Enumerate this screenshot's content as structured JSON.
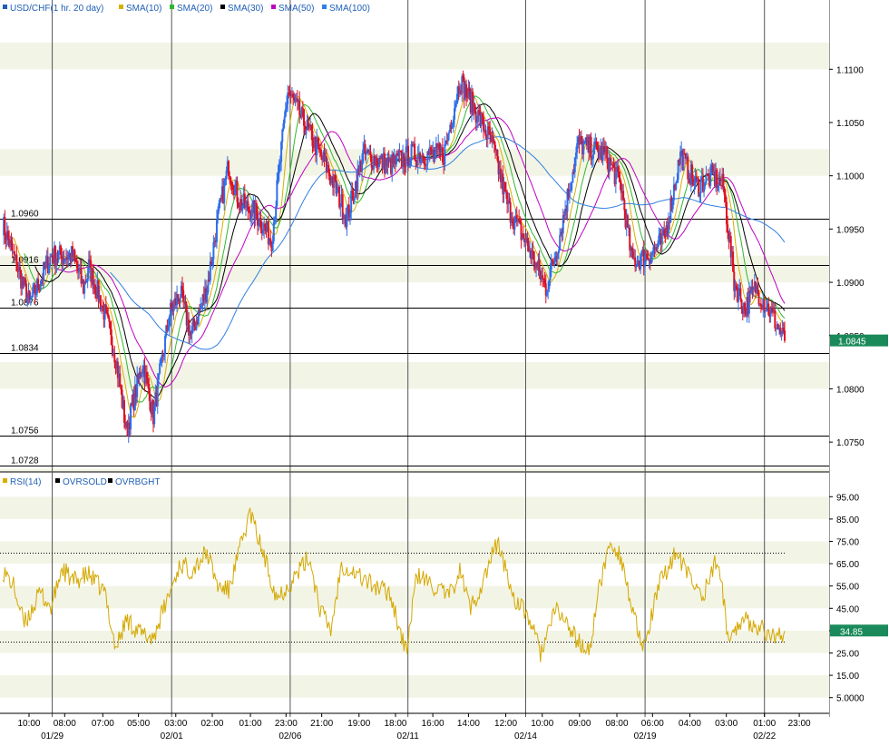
{
  "header": {
    "symbol": "USD/CHF",
    "timeframe": "(1 hr.  20 day)",
    "indicators": [
      {
        "label": "SMA(10)",
        "color": "#d4b000"
      },
      {
        "label": "SMA(20)",
        "color": "#2eb82e"
      },
      {
        "label": "SMA(30)",
        "color": "#000000"
      },
      {
        "label": "SMA(50)",
        "color": "#c000c0"
      },
      {
        "label": "SMA(100)",
        "color": "#2f7fe0"
      }
    ]
  },
  "rsi_header": {
    "indicators": [
      {
        "label": "RSI(14)",
        "color": "#d4b000"
      },
      {
        "label": "OVRSOLD",
        "color": "#000000"
      },
      {
        "label": "OVRBGHT",
        "color": "#000000"
      }
    ]
  },
  "colors": {
    "up": "#2f6fe8",
    "down": "#e01020",
    "tag_bg": "#1a8a5a",
    "band": "#f2f4e6",
    "rsi": "#d4a800"
  },
  "chart_data": [
    {
      "type": "candlestick",
      "title": "USD/CHF",
      "y_ticks": [
        "1.1100",
        "1.1050",
        "1.1000",
        "1.0950",
        "1.0900",
        "1.0850",
        "1.0800",
        "1.0750"
      ],
      "y_tick_values": [
        1.11,
        1.105,
        1.1,
        1.095,
        1.09,
        1.085,
        1.08,
        1.075
      ],
      "ylim": [
        1.0722,
        1.1165
      ],
      "horizontal_lines": [
        {
          "value": 1.096,
          "label": "1.0960"
        },
        {
          "value": 1.0916,
          "label": "1.0916"
        },
        {
          "value": 1.0876,
          "label": "1.0876"
        },
        {
          "value": 1.0834,
          "label": "1.0834"
        },
        {
          "value": 1.0756,
          "label": "1.0756"
        },
        {
          "value": 1.0728,
          "label": "1.0728"
        }
      ],
      "last_price": "1.0845",
      "last_value": 1.0845,
      "anchors": [
        [
          0,
          1.0955
        ],
        [
          10,
          1.0925
        ],
        [
          25,
          1.088
        ],
        [
          45,
          1.0925
        ],
        [
          65,
          1.0925
        ],
        [
          75,
          1.0895
        ],
        [
          80,
          1.0915
        ],
        [
          95,
          1.087
        ],
        [
          105,
          1.083
        ],
        [
          115,
          1.076
        ],
        [
          130,
          1.0825
        ],
        [
          140,
          1.0775
        ],
        [
          155,
          1.087
        ],
        [
          165,
          1.089
        ],
        [
          175,
          1.085
        ],
        [
          190,
          1.0895
        ],
        [
          200,
          1.096
        ],
        [
          210,
          1.101
        ],
        [
          220,
          1.0975
        ],
        [
          235,
          1.0965
        ],
        [
          250,
          1.094
        ],
        [
          265,
          1.108
        ],
        [
          285,
          1.104
        ],
        [
          305,
          1.1
        ],
        [
          320,
          1.096
        ],
        [
          335,
          1.102
        ],
        [
          360,
          1.101
        ],
        [
          380,
          1.102
        ],
        [
          410,
          1.102
        ],
        [
          425,
          1.109
        ],
        [
          440,
          1.106
        ],
        [
          455,
          1.103
        ],
        [
          470,
          1.097
        ],
        [
          490,
          1.093
        ],
        [
          505,
          1.0895
        ],
        [
          515,
          1.093
        ],
        [
          535,
          1.103
        ],
        [
          560,
          1.102
        ],
        [
          575,
          1.099
        ],
        [
          585,
          1.092
        ],
        [
          600,
          1.0925
        ],
        [
          615,
          1.094
        ],
        [
          630,
          1.102
        ],
        [
          645,
          1.099
        ],
        [
          660,
          1.1
        ],
        [
          670,
          1.099
        ],
        [
          680,
          1.09
        ],
        [
          690,
          1.0875
        ],
        [
          700,
          1.0895
        ],
        [
          715,
          1.087
        ],
        [
          727,
          1.0845
        ]
      ],
      "rsi": {
        "name": "RSI(14)",
        "y_ticks": [
          "95.00",
          "85.00",
          "75.00",
          "65.00",
          "55.00",
          "45.00",
          "35.00",
          "25.00",
          "15.00",
          "5.0000"
        ],
        "y_tick_values": [
          95,
          85,
          75,
          65,
          55,
          45,
          35,
          25,
          15,
          5
        ],
        "ylim": [
          0,
          100
        ],
        "overbought": 70,
        "oversold": 30,
        "last_value": "34.85",
        "anchors": [
          [
            0,
            62
          ],
          [
            10,
            55
          ],
          [
            20,
            38
          ],
          [
            35,
            52
          ],
          [
            45,
            45
          ],
          [
            55,
            63
          ],
          [
            65,
            57
          ],
          [
            80,
            60
          ],
          [
            95,
            52
          ],
          [
            105,
            27
          ],
          [
            115,
            40
          ],
          [
            130,
            33
          ],
          [
            140,
            32
          ],
          [
            150,
            45
          ],
          [
            165,
            65
          ],
          [
            175,
            62
          ],
          [
            190,
            70
          ],
          [
            200,
            55
          ],
          [
            210,
            53
          ],
          [
            230,
            88
          ],
          [
            245,
            65
          ],
          [
            255,
            50
          ],
          [
            265,
            55
          ],
          [
            285,
            68
          ],
          [
            295,
            45
          ],
          [
            305,
            35
          ],
          [
            315,
            65
          ],
          [
            330,
            60
          ],
          [
            345,
            55
          ],
          [
            360,
            52
          ],
          [
            375,
            25
          ],
          [
            385,
            60
          ],
          [
            400,
            55
          ],
          [
            415,
            50
          ],
          [
            425,
            62
          ],
          [
            435,
            45
          ],
          [
            445,
            55
          ],
          [
            460,
            75
          ],
          [
            475,
            50
          ],
          [
            490,
            40
          ],
          [
            500,
            25
          ],
          [
            515,
            45
          ],
          [
            535,
            30
          ],
          [
            545,
            25
          ],
          [
            555,
            55
          ],
          [
            565,
            75
          ],
          [
            575,
            68
          ],
          [
            585,
            45
          ],
          [
            595,
            25
          ],
          [
            610,
            55
          ],
          [
            625,
            70
          ],
          [
            640,
            58
          ],
          [
            650,
            50
          ],
          [
            665,
            68
          ],
          [
            675,
            30
          ],
          [
            685,
            40
          ],
          [
            700,
            38
          ],
          [
            715,
            32
          ],
          [
            727,
            34.85
          ]
        ]
      },
      "x_ticks": [
        {
          "label": "10:00",
          "x": 0.035
        },
        {
          "label": "08:00",
          "x": 0.078
        },
        {
          "label": "07:00",
          "x": 0.124
        },
        {
          "label": "05:00",
          "x": 0.167
        },
        {
          "label": "03:00",
          "x": 0.212
        },
        {
          "label": "02:00",
          "x": 0.256
        },
        {
          "label": "01:00",
          "x": 0.302
        },
        {
          "label": "23:00",
          "x": 0.345
        },
        {
          "label": "21:00",
          "x": 0.388
        },
        {
          "label": "19:00",
          "x": 0.433
        },
        {
          "label": "18:00",
          "x": 0.477
        },
        {
          "label": "16:00",
          "x": 0.522
        },
        {
          "label": "14:00",
          "x": 0.565
        },
        {
          "label": "12:00",
          "x": 0.61
        },
        {
          "label": "10:00",
          "x": 0.654
        },
        {
          "label": "09:00",
          "x": 0.699
        },
        {
          "label": "08:00",
          "x": 0.744
        },
        {
          "label": "06:00",
          "x": 0.787
        },
        {
          "label": "04:00",
          "x": 0.832
        },
        {
          "label": "03:00",
          "x": 0.876
        },
        {
          "label": "01:00",
          "x": 0.922
        },
        {
          "label": "23:00",
          "x": 0.964
        }
      ],
      "date_labels": [
        {
          "label": "01/29",
          "x": 0.063
        },
        {
          "label": "02/01",
          "x": 0.207
        },
        {
          "label": "02/06",
          "x": 0.35
        },
        {
          "label": "02/11",
          "x": 0.492
        },
        {
          "label": "02/14",
          "x": 0.634
        },
        {
          "label": "02/19",
          "x": 0.778
        },
        {
          "label": "02/22",
          "x": 0.922
        }
      ],
      "session_dividers": [
        0.063,
        0.207,
        0.35,
        0.492,
        0.634,
        0.778,
        0.922
      ]
    }
  ]
}
